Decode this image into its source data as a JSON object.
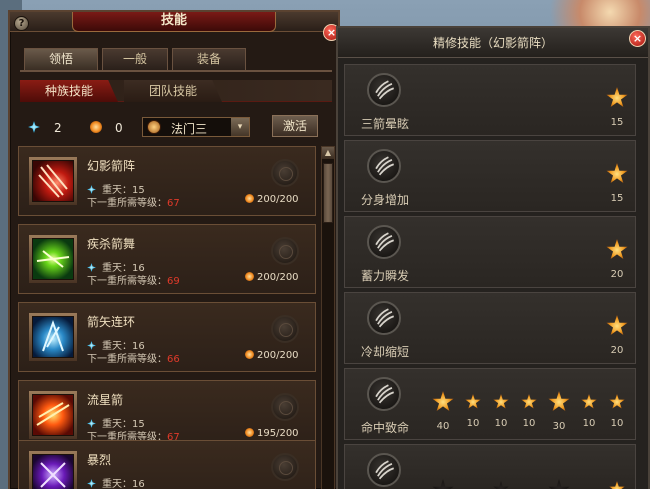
{
  "window": {
    "title": "技能",
    "help_label": "?",
    "close_label": "×"
  },
  "tabs": [
    {
      "label": "领悟",
      "active": true
    },
    {
      "label": "一般",
      "active": false
    },
    {
      "label": "装备",
      "active": false
    }
  ],
  "subtabs": [
    {
      "label": "种族技能",
      "active": true
    },
    {
      "label": "团队技能",
      "active": false
    }
  ],
  "points": {
    "blue": "2",
    "orange": "0"
  },
  "selector": {
    "value": "法门三",
    "arrow": "▾"
  },
  "activate_label": "激活",
  "layer_prefix": "重天：",
  "req_prefix": "下一重所需等级：",
  "skills": [
    {
      "name": "幻影箭阵",
      "layer": "15",
      "req_level": "67",
      "cost": "200/200",
      "icon": "arrow-rain-icon",
      "tone": "red"
    },
    {
      "name": "疾杀箭舞",
      "layer": "16",
      "req_level": "69",
      "cost": "200/200",
      "icon": "arrow-dance-icon",
      "tone": "green"
    },
    {
      "name": "箭矢连环",
      "layer": "16",
      "req_level": "66",
      "cost": "200/200",
      "icon": "chain-arrow-icon",
      "tone": "blue"
    },
    {
      "name": "流星箭",
      "layer": "15",
      "req_level": "67",
      "cost": "195/200",
      "icon": "meteor-arrow-icon",
      "tone": "fire"
    },
    {
      "name": "暴烈",
      "layer": "16",
      "req_level": "",
      "cost": "",
      "icon": "burst-icon",
      "tone": "purple"
    }
  ],
  "refine_panel": {
    "title": "精修技能（幻影箭阵）",
    "close_label": "×",
    "rows": [
      {
        "name": "三箭晕眩",
        "stars": [
          {
            "value": "15",
            "lit": true
          }
        ]
      },
      {
        "name": "分身增加",
        "stars": [
          {
            "value": "15",
            "lit": true
          }
        ]
      },
      {
        "name": "蓄力瞬发",
        "stars": [
          {
            "value": "20",
            "lit": true
          }
        ]
      },
      {
        "name": "冷却缩短",
        "stars": [
          {
            "value": "20",
            "lit": true
          }
        ]
      },
      {
        "name": "命中致命",
        "stars": [
          {
            "value": "40",
            "lit": true,
            "big": true
          },
          {
            "value": "10",
            "lit": true
          },
          {
            "value": "10",
            "lit": true
          },
          {
            "value": "10",
            "lit": true
          },
          {
            "value": "30",
            "lit": true,
            "big": true
          },
          {
            "value": "10",
            "lit": true
          },
          {
            "value": "10",
            "lit": true
          }
        ]
      },
      {
        "name": "",
        "stars": []
      }
    ]
  },
  "colors": {
    "panel_bg": "#241a14",
    "accent_red": "#8a1c14",
    "level_red": "#e03a2a",
    "text_gold": "#f0e0c0"
  }
}
